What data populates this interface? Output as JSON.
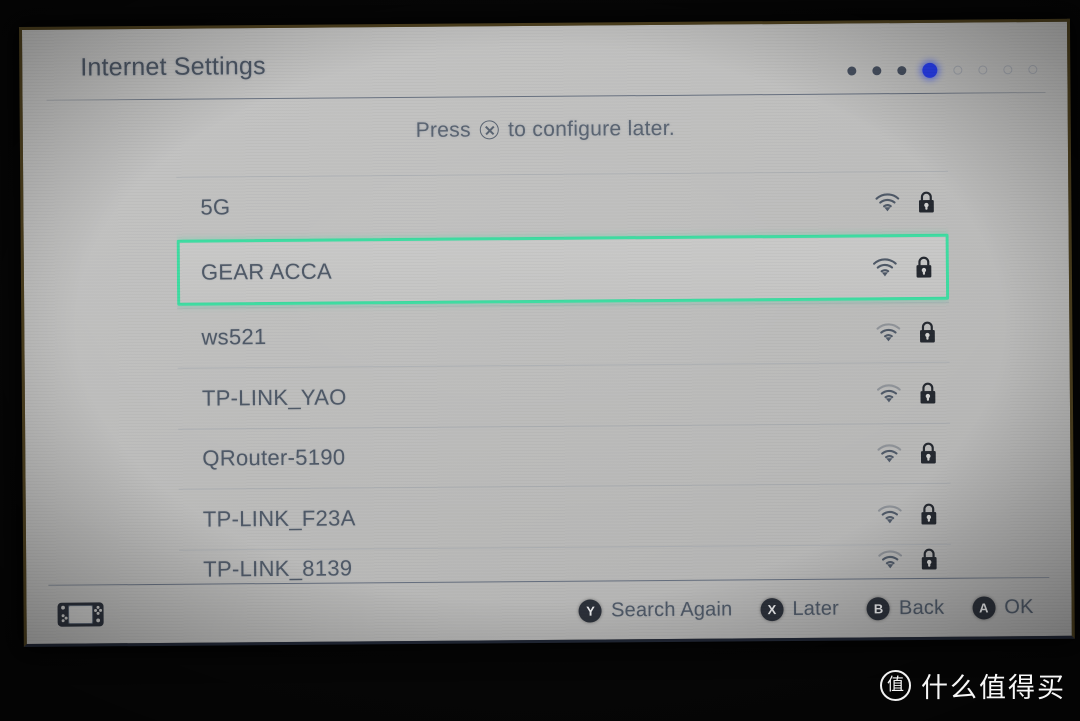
{
  "screen": {
    "title": "Internet Settings",
    "instruction_prefix": "Press",
    "instruction_glyph": "x-button-circle-icon",
    "instruction_suffix": "to configure later.",
    "page_dots": [
      {
        "state": "visited"
      },
      {
        "state": "visited"
      },
      {
        "state": "visited"
      },
      {
        "state": "active"
      },
      {
        "state": "upcoming"
      },
      {
        "state": "upcoming"
      },
      {
        "state": "upcoming"
      },
      {
        "state": "upcoming"
      }
    ],
    "networks": [
      {
        "ssid": "5G",
        "signal": 3,
        "secured": true,
        "selected": false,
        "clipped": false
      },
      {
        "ssid": "GEAR ACCA",
        "signal": 3,
        "secured": true,
        "selected": true,
        "clipped": false
      },
      {
        "ssid": "ws521",
        "signal": 2,
        "secured": true,
        "selected": false,
        "clipped": false
      },
      {
        "ssid": "TP-LINK_YAO",
        "signal": 2,
        "secured": true,
        "selected": false,
        "clipped": false
      },
      {
        "ssid": "QRouter-5190",
        "signal": 2,
        "secured": true,
        "selected": false,
        "clipped": false
      },
      {
        "ssid": "TP-LINK_F23A",
        "signal": 2,
        "secured": true,
        "selected": false,
        "clipped": false
      },
      {
        "ssid": "TP-LINK_8139",
        "signal": 2,
        "secured": true,
        "selected": false,
        "clipped": true
      }
    ],
    "bottom_bar": {
      "mode_icon": "handheld-console-icon",
      "actions": [
        {
          "button": "Y",
          "label": "Search Again"
        },
        {
          "button": "X",
          "label": "Later"
        },
        {
          "button": "B",
          "label": "Back"
        },
        {
          "button": "A",
          "label": "OK"
        }
      ]
    }
  },
  "watermark": {
    "badge": "值",
    "text": "什么值得买"
  },
  "colors": {
    "selection_border": "#3ddca1",
    "active_dot": "#1a31f0",
    "text": "#4e5866",
    "screen_bg": "#bdbdbc"
  }
}
